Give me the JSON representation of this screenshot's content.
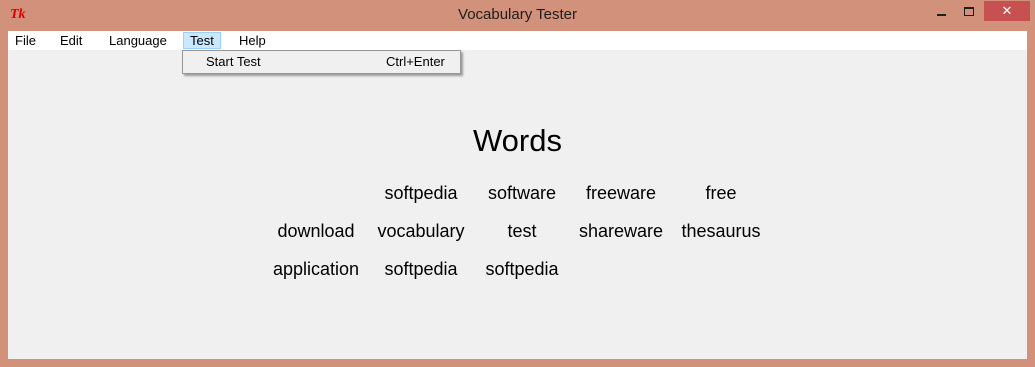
{
  "window": {
    "title": "Vocabulary Tester",
    "app_icon": "tk-feather-icon",
    "app_icon_text": "Tk",
    "controls": {
      "minimize_icon": "minimize-icon",
      "maximize_icon": "maximize-icon",
      "close_icon": "close-icon",
      "close_glyph": "✕"
    }
  },
  "menubar": {
    "items": [
      {
        "label": "File"
      },
      {
        "label": "Edit"
      },
      {
        "label": "Language"
      },
      {
        "label": "Test",
        "open": true
      },
      {
        "label": "Help"
      }
    ]
  },
  "test_menu": {
    "items": [
      {
        "label": "Start Test",
        "accelerator": "Ctrl+Enter"
      }
    ]
  },
  "main": {
    "heading": "Words",
    "words": [
      [
        "",
        "softpedia",
        "software",
        "freeware",
        "free"
      ],
      [
        "download",
        "vocabulary",
        "test",
        "shareware",
        "thesaurus"
      ],
      [
        "application",
        "softpedia",
        "softpedia",
        "",
        ""
      ]
    ]
  },
  "colors": {
    "frame": "#d1917a",
    "client_bg": "#f0f0f0",
    "menu_highlight": "#cce8ff",
    "close_button": "#c75050"
  }
}
